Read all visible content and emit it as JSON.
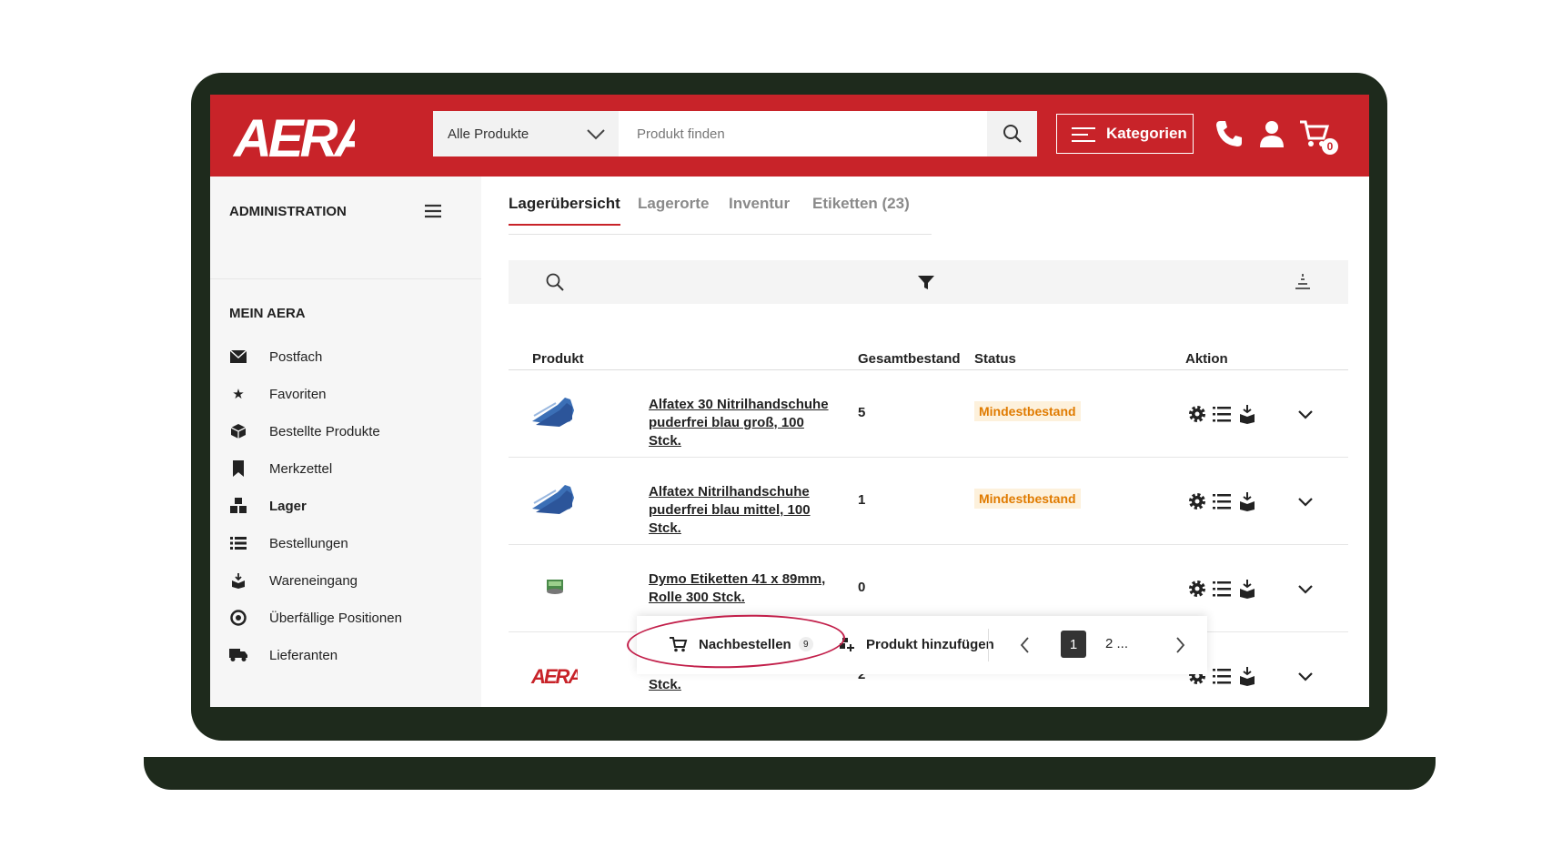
{
  "header": {
    "logo_text": "AERA",
    "scope_select": "Alle Produkte",
    "search_placeholder": "Produkt finden",
    "categories_label": "Kategorien",
    "cart_count": "0",
    "brand_color": "#c82329"
  },
  "sidebar": {
    "admin_heading": "ADMINISTRATION",
    "section_heading": "MEIN AERA",
    "items": [
      {
        "label": "Postfach",
        "icon": "envelope-icon"
      },
      {
        "label": "Favoriten",
        "icon": "star-icon"
      },
      {
        "label": "Bestellte Produkte",
        "icon": "box-icon"
      },
      {
        "label": "Merkzettel",
        "icon": "bookmark-icon"
      },
      {
        "label": "Lager",
        "icon": "warehouse-icon",
        "active": true
      },
      {
        "label": "Bestellungen",
        "icon": "list-icon"
      },
      {
        "label": "Wareneingang",
        "icon": "incoming-goods-icon"
      },
      {
        "label": "Überfällige Positionen",
        "icon": "overdue-icon"
      },
      {
        "label": "Lieferanten",
        "icon": "truck-icon"
      }
    ]
  },
  "tabs": [
    {
      "label": "Lagerübersicht",
      "active": true
    },
    {
      "label": "Lagerorte"
    },
    {
      "label": "Inventur"
    },
    {
      "label": "Etiketten (23)"
    }
  ],
  "table": {
    "headers": {
      "product": "Produkt",
      "stock": "Gesamtbestand",
      "status": "Status",
      "action": "Aktion"
    },
    "rows": [
      {
        "name": "Alfatex 30 Nitrilhandschuhe puderfrei blau groß, 100 Stck.",
        "stock": "5",
        "status": "Mindestbestand",
        "image": "blue-gloves-image"
      },
      {
        "name": "Alfatex Nitrilhandschuhe puderfrei blau mittel, 100 Stck.",
        "stock": "1",
        "status": "Mindestbestand",
        "image": "blue-gloves-image"
      },
      {
        "name": "Dymo Etiketten 41 x 89mm, Rolle 300 Stck.",
        "stock": "0",
        "status": "",
        "image": "label-roll-image"
      },
      {
        "name": "AERA Beispielprodukt, 1 Stck.",
        "stock": "2",
        "status": "",
        "image": "aera-logo-image"
      }
    ]
  },
  "actionbar": {
    "reorder_label": "Nachbestellen",
    "reorder_count": "9",
    "add_product_label": "Produkt hinzufügen",
    "current_page": "1",
    "more_pages": "2 ..."
  }
}
